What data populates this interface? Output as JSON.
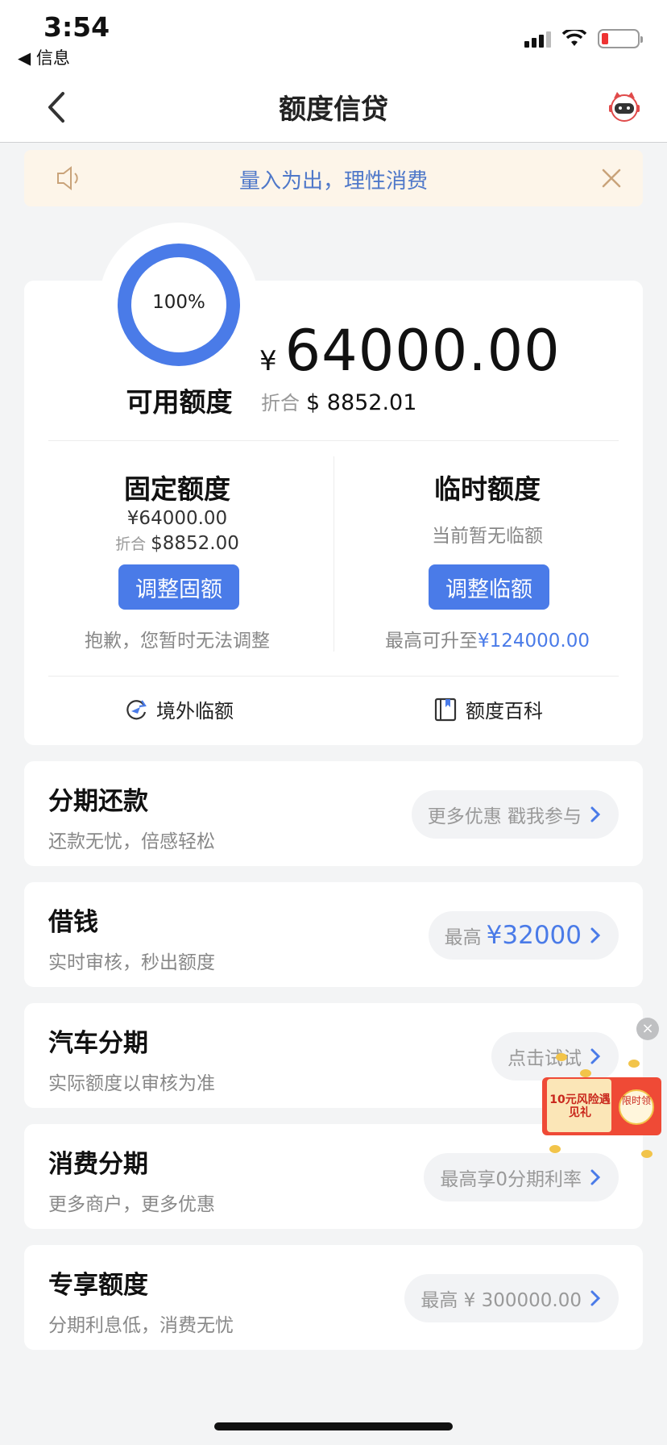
{
  "status_bar": {
    "time": "3:54",
    "back_app": "◀ 信息",
    "icons": [
      "signal-icon",
      "wifi-icon",
      "battery-low-icon"
    ]
  },
  "nav": {
    "title": "额度信贷",
    "back_icon": "chevron-left-icon",
    "assistant_icon": "robot-assistant-icon"
  },
  "notice": {
    "text": "量入为出，理性消费"
  },
  "credit": {
    "percent": "100%",
    "percent_value": 1.0,
    "available_label": "可用额度",
    "currency_symbol": "¥",
    "amount": "64000.00",
    "converted_prefix": "折合",
    "converted_amount": "$ 8852.01"
  },
  "fixed": {
    "title": "固定额度",
    "amount": "¥64000.00",
    "converted_prefix": "折合",
    "converted_amount": "$8852.00",
    "button": "调整固额",
    "note": "抱歉，您暂时无法调整"
  },
  "temporary": {
    "title": "临时额度",
    "status": "当前暂无临额",
    "button": "调整临额",
    "note_prefix": "最高可升至",
    "note_amount": "¥124000.00"
  },
  "links": {
    "overseas": "境外临额",
    "encyclopedia": "额度百科"
  },
  "products": [
    {
      "title": "分期还款",
      "subtitle": "还款无忧，倍感轻松",
      "pill_text": "更多优惠 戳我参与",
      "pill_highlight": ""
    },
    {
      "title": "借钱",
      "subtitle": "实时审核，秒出额度",
      "pill_text": "最高",
      "pill_highlight": "¥32000"
    },
    {
      "title": "汽车分期",
      "subtitle": "实际额度以审核为准",
      "pill_text": "点击试试",
      "pill_highlight": ""
    },
    {
      "title": "消费分期",
      "subtitle": "更多商户，更多优惠",
      "pill_text": "最高享0分期利率",
      "pill_highlight": ""
    },
    {
      "title": "专享额度",
      "subtitle": "分期利息低，消费无忧",
      "pill_text": "最高 ¥ 300000.00",
      "pill_highlight": ""
    }
  ],
  "promo": {
    "title": "10元风险遇见礼",
    "badge": "限时领",
    "close": "×"
  },
  "colors": {
    "accent": "#4a7be8",
    "notice_bg": "#fdf5e9",
    "notice_text": "#4f78c9",
    "page_bg": "#f3f4f5"
  }
}
